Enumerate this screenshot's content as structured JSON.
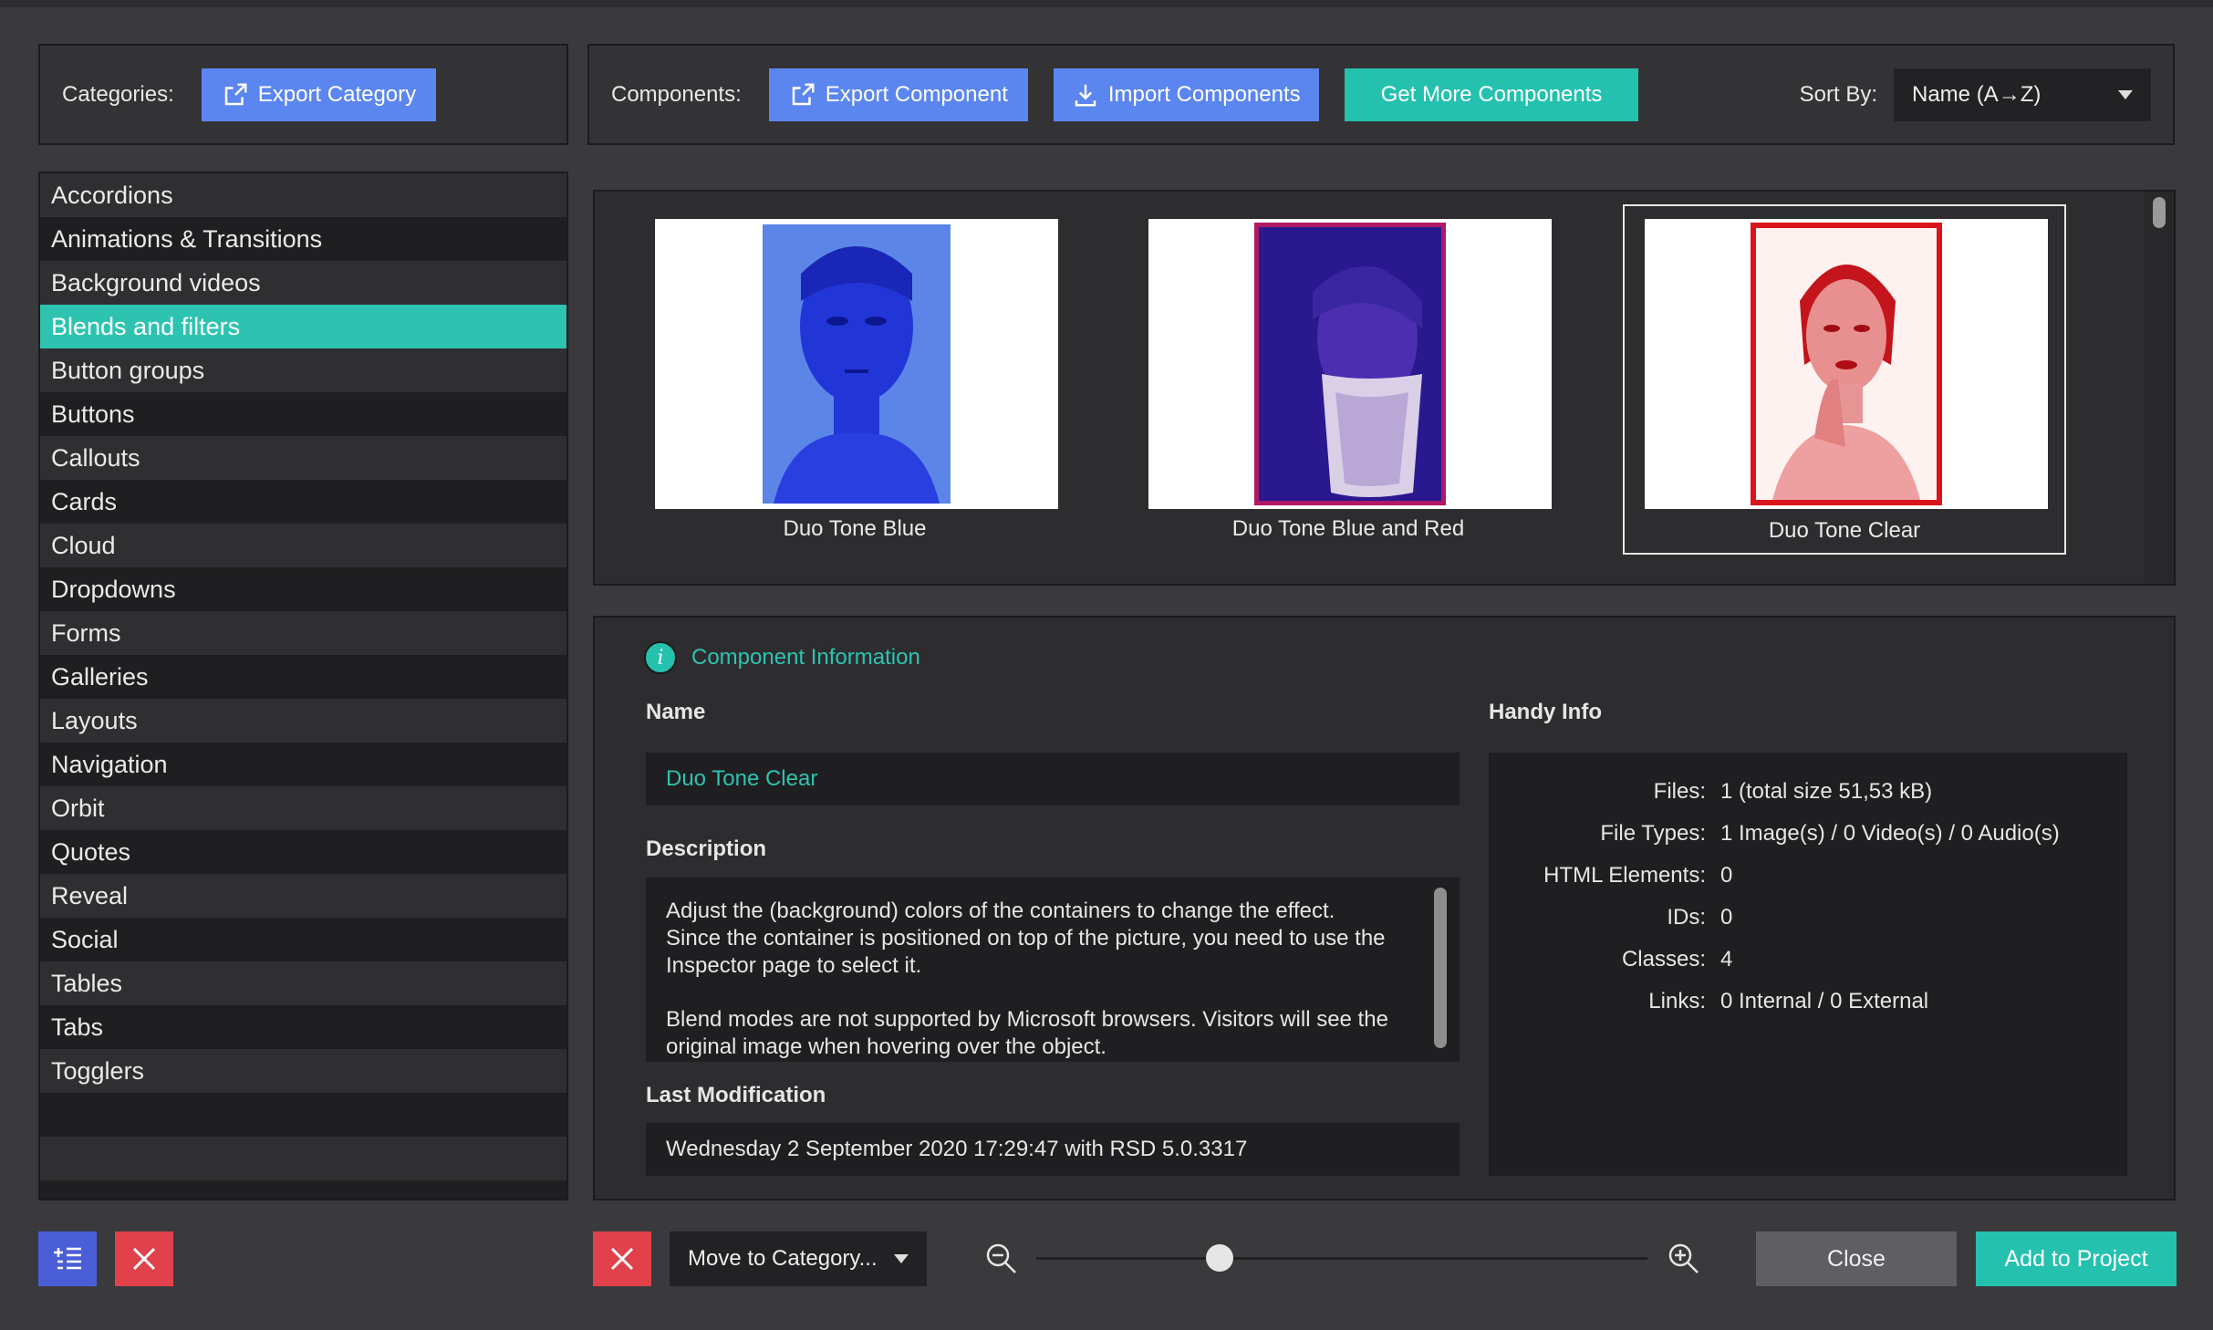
{
  "toolbar_left": {
    "label": "Categories:",
    "export_category": "Export Category"
  },
  "toolbar_right": {
    "label": "Components:",
    "export_component": "Export Component",
    "import_components": "Import Components",
    "get_more": "Get More Components",
    "sort_label": "Sort By:",
    "sort_value": "Name (A→Z)"
  },
  "categories": [
    "Accordions",
    "Animations & Transitions",
    "Background videos",
    "Blends and filters",
    "Button groups",
    "Buttons",
    "Callouts",
    "Cards",
    "Cloud",
    "Dropdowns",
    "Forms",
    "Galleries",
    "Layouts",
    "Navigation",
    "Orbit",
    "Quotes",
    "Reveal",
    "Social",
    "Tables",
    "Tabs",
    "Togglers"
  ],
  "selected_category": "Blends and filters",
  "components": [
    {
      "label": "Duo Tone Blue",
      "image": "blue-duotone-portrait-image"
    },
    {
      "label": "Duo Tone Blue and Red",
      "image": "blue-red-duotone-portrait-image"
    },
    {
      "label": "Duo Tone Clear",
      "image": "red-duotone-portrait-image"
    }
  ],
  "info": {
    "title": "Component Information",
    "name_label": "Name",
    "name_value": "Duo Tone Clear",
    "description_label": "Description",
    "description_p1": "Adjust the (background) colors of the containers to change the effect. Since the container is positioned on top of the picture, you need to use the Inspector page to select it.",
    "description_p2": "Blend modes are not supported by Microsoft browsers. Visitors will see the original image when hovering over the object.",
    "modification_label": "Last Modification",
    "modification_value": "Wednesday 2 September 2020 17:29:47 with RSD 5.0.3317",
    "handy_label": "Handy Info",
    "handy": {
      "files_key": "Files:",
      "files_val": "1 (total size 51,53 kB)",
      "types_key": "File Types:",
      "types_val": "1 Image(s) / 0 Video(s) / 0 Audio(s)",
      "html_key": "HTML Elements:",
      "html_val": "0",
      "ids_key": "IDs:",
      "ids_val": "0",
      "classes_key": "Classes:",
      "classes_val": "4",
      "links_key": "Links:",
      "links_val": "0 Internal / 0 External"
    }
  },
  "bottom": {
    "move_to_category": "Move to Category...",
    "close": "Close",
    "add_to_project": "Add to Project",
    "zoom_level": 0.3
  },
  "colors": {
    "accent": "#24c1ae",
    "button_blue": "#5b86f0",
    "delete_red": "#e0414b"
  }
}
